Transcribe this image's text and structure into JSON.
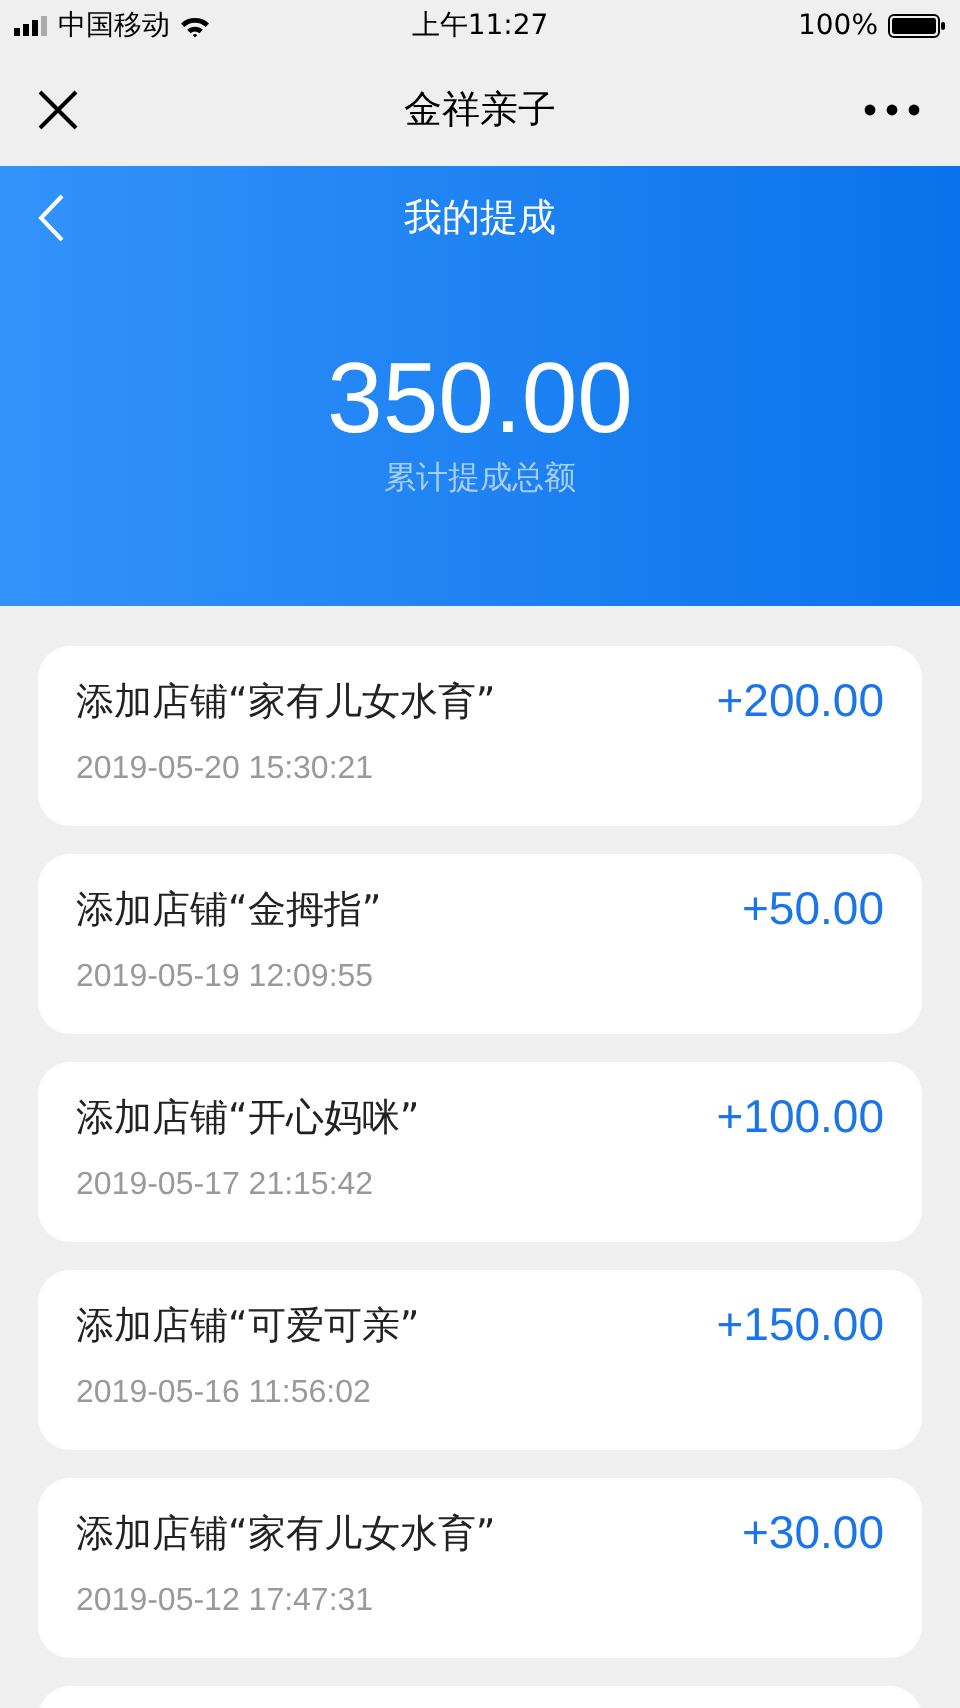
{
  "status_bar": {
    "carrier": "中国移动",
    "time": "上午11:27",
    "battery": "100%"
  },
  "nav_bar": {
    "title": "金祥亲子"
  },
  "header": {
    "title": "我的提成",
    "total": "350.00",
    "total_label": "累计提成总额"
  },
  "records": [
    {
      "title": "添加店铺“家有儿女水育”",
      "time": "2019-05-20 15:30:21",
      "amount": "+200.00"
    },
    {
      "title": "添加店铺“金拇指”",
      "time": "2019-05-19 12:09:55",
      "amount": "+50.00"
    },
    {
      "title": "添加店铺“开心妈咪”",
      "time": "2019-05-17 21:15:42",
      "amount": "+100.00"
    },
    {
      "title": "添加店铺“可爱可亲”",
      "time": "2019-05-16 11:56:02",
      "amount": "+150.00"
    },
    {
      "title": "添加店铺“家有儿女水育”",
      "time": "2019-05-12 17:47:31",
      "amount": "+30.00"
    }
  ]
}
